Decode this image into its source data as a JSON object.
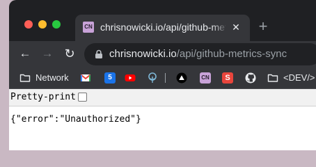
{
  "tab": {
    "favicon_text": "CN",
    "title": "chrisnowicki.io/api/github-metrics-sync",
    "close_glyph": "✕"
  },
  "new_tab_glyph": "+",
  "nav": {
    "back_glyph": "←",
    "forward_glyph": "→",
    "reload_glyph": "↻"
  },
  "address": {
    "host": "chrisnowicki.io",
    "path": "/api/github-metrics-sync"
  },
  "bookmarks": {
    "network_label": "Network",
    "icons": [
      "gmail-icon",
      "calendar-icon",
      "youtube-icon",
      "tree-icon",
      "vercel-icon",
      "cn-icon",
      "s-icon",
      "github-icon"
    ],
    "calendar_text": "5",
    "cn_text": "CN",
    "s_text": "S",
    "dev_label": "<DEV/>"
  },
  "page": {
    "pretty_print_label": "Pretty-print",
    "json_text": "{\"error\":\"Unauthorized\"}"
  },
  "colors": {
    "tab_bar": "#1f2023",
    "toolbar": "#35363a",
    "omnibox": "#202124",
    "page_background": "#ffffff"
  }
}
